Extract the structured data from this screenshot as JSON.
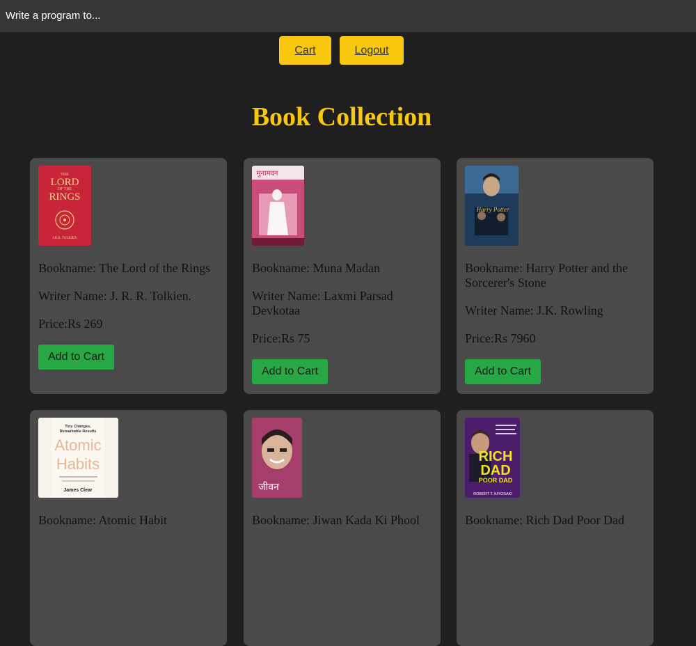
{
  "window": {
    "title": "Write a program to..."
  },
  "nav": {
    "cart_label": "Cart",
    "logout_label": "Logout"
  },
  "page": {
    "heading": "Book Collection"
  },
  "labels": {
    "bookname": "Bookname: ",
    "writer": "Writer Name: ",
    "price": "Price:",
    "add_to_cart": "Add to Cart"
  },
  "colors": {
    "accent": "#f9c80e",
    "button": "#28a745",
    "card": "#4a4a4a",
    "background": "#1f1f1f"
  },
  "books": [
    {
      "name": "The Lord of the Rings",
      "writer": "J. R. R. Tolkien.",
      "price": "Rs 269",
      "cover": {
        "lines": [
          "THE",
          "LORD",
          "OF THE",
          "RINGS",
          "J.R.R. TOLKIEN"
        ],
        "icon": "ring-emblem-icon"
      }
    },
    {
      "name": "Muna Madan",
      "writer": "Laxmi Parsad Devkotaa",
      "price": "Rs 75",
      "cover": {
        "lines": [
          "मुनामदन"
        ],
        "icon": "figure-illustration-icon"
      }
    },
    {
      "name": "Harry Potter and the Sorcerer's Stone",
      "writer": "J.K. Rowling",
      "price": "Rs 7960",
      "cover": {
        "lines": [
          "Harry Potter"
        ],
        "icon": "movie-poster-icon"
      }
    },
    {
      "name": "Atomic Habit",
      "writer": "",
      "price": "",
      "cover": {
        "lines": [
          "Tiny Changes,",
          "Remarkable Results",
          "Atomic",
          "Habits",
          "James Clear"
        ],
        "icon": "book-cover-icon"
      }
    },
    {
      "name": "Jiwan Kada Ki Phool",
      "writer": "",
      "price": "",
      "cover": {
        "lines": [
          "जीवन"
        ],
        "icon": "portrait-icon"
      }
    },
    {
      "name": "Rich Dad Poor Dad",
      "writer": "",
      "price": "",
      "cover": {
        "lines": [
          "RICH",
          "DAD",
          "POOR DAD",
          "ROBERT T. KIYOSAKI"
        ],
        "icon": "portrait-icon"
      }
    }
  ]
}
